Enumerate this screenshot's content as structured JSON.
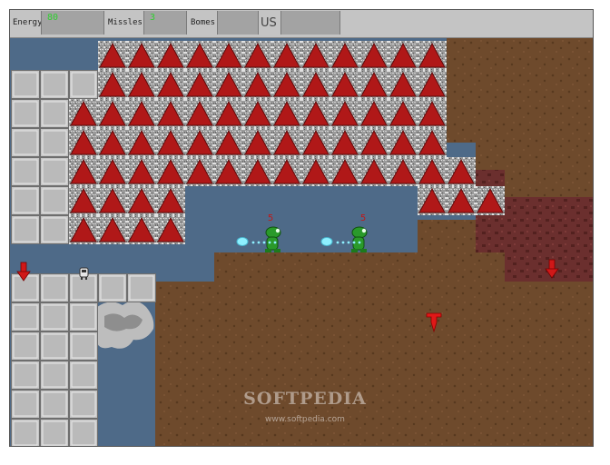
{
  "hud": {
    "energy_label": "Energy",
    "energy_value": "80",
    "missiles_label": "Missles",
    "missiles_value": "3",
    "bombs_label": "Bomes",
    "bombs_value": "",
    "slot_value": "",
    "us_label": "US"
  },
  "enemies": [
    {
      "hp": "5"
    },
    {
      "hp": "5"
    }
  ],
  "watermark": {
    "brand": "SOFTPEDIA",
    "url": "www.softpedia.com"
  },
  "colors": {
    "water": "#4e6a88",
    "dirt": "#6e4a2c",
    "rock": "#6b2f2e",
    "spike": "#b01818",
    "block": "#bcbcbc",
    "enemy": "#2a9a2a",
    "beam": "#8ef0ff",
    "hud_text_green": "#30d030"
  }
}
